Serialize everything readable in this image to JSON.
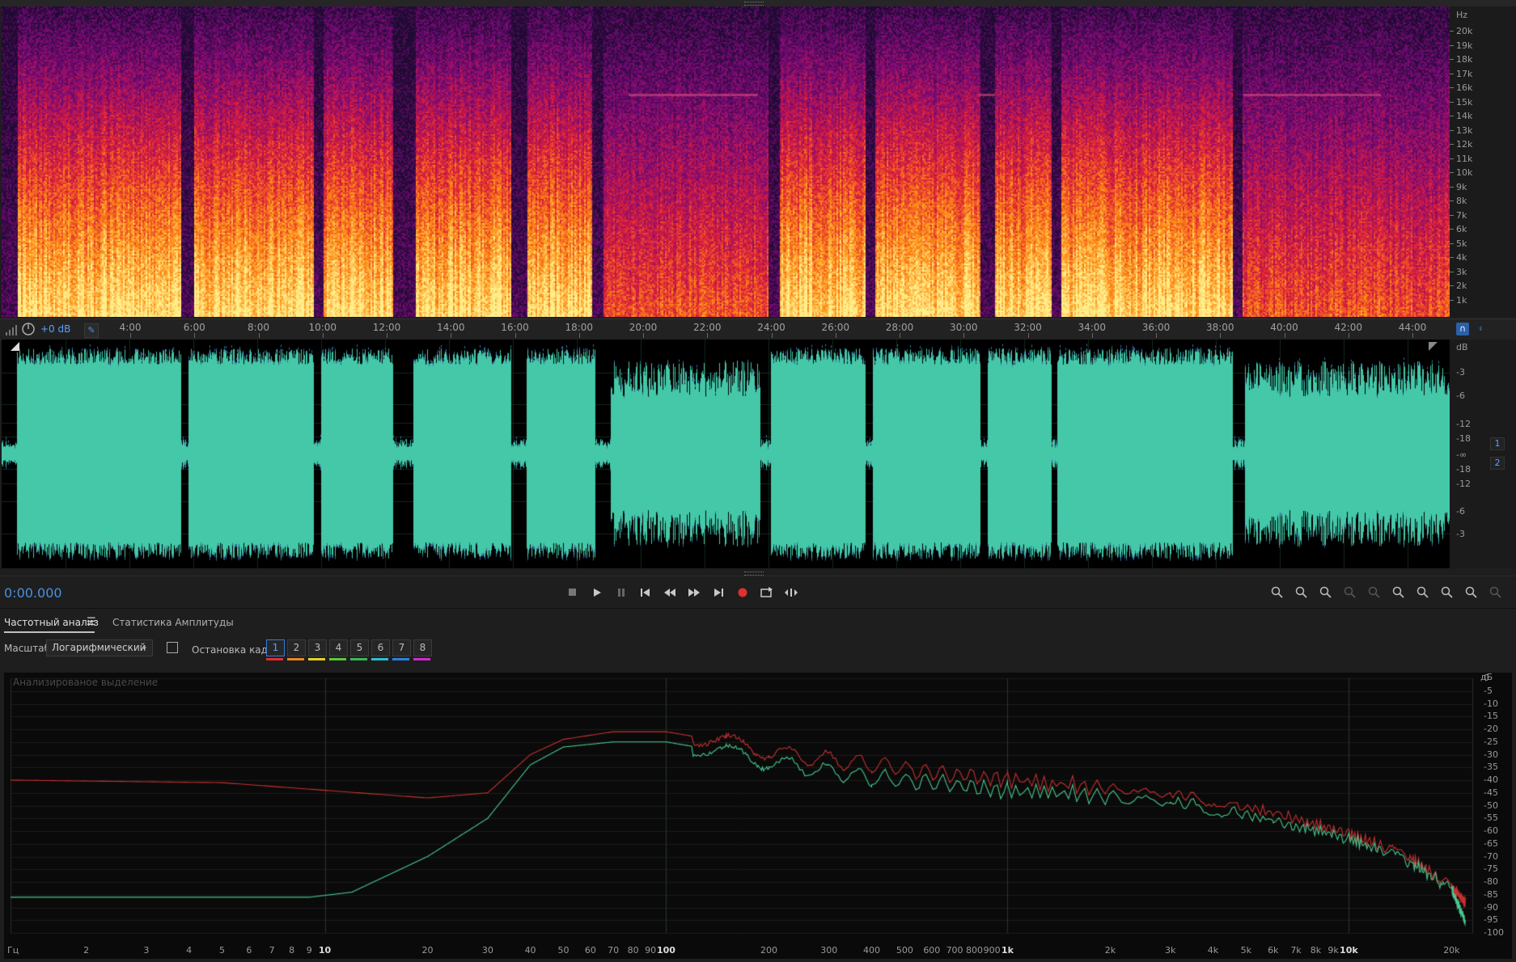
{
  "spectrogram": {
    "unit": "Hz",
    "freq_labels": [
      "20k",
      "19k",
      "18k",
      "17k",
      "16k",
      "15k",
      "14k",
      "13k",
      "12k",
      "11k",
      "10k",
      "9k",
      "8k",
      "7k",
      "6k",
      "5k",
      "4k",
      "3k",
      "2k",
      "1k"
    ]
  },
  "timeline": {
    "gain_label": "+0 dB",
    "labels": [
      "4:00",
      "6:00",
      "8:00",
      "10:00",
      "12:00",
      "14:00",
      "16:00",
      "18:00",
      "20:00",
      "22:00",
      "24:00",
      "26:00",
      "28:00",
      "30:00",
      "32:00",
      "34:00",
      "36:00",
      "38:00",
      "40:00",
      "42:00",
      "44:00"
    ]
  },
  "waveform": {
    "unit": "dB",
    "db_labels": [
      "-3",
      "-6",
      "-12",
      "-18",
      "-∞",
      "-18",
      "-12",
      "-6",
      "-3"
    ],
    "channels": [
      "1",
      "2"
    ],
    "color": "#44c8a8"
  },
  "transport": {
    "time": "0:00.000",
    "icons": [
      "stop-icon",
      "play-icon",
      "pause-icon",
      "skip-start-icon",
      "rewind-icon",
      "fast-forward-icon",
      "skip-end-icon",
      "record-icon",
      "loop-icon",
      "skip-selection-icon"
    ]
  },
  "zoom": {
    "icons": [
      "zoom-in-amplitude-icon",
      "zoom-out-amplitude-icon",
      "zoom-in-time-icon",
      "zoom-out-time-icon",
      "zoom-full-icon",
      "zoom-in-left-icon",
      "zoom-in-right-icon",
      "zoom-to-selection-icon",
      "zoom-reset-icon",
      "zoom-toggle-icon"
    ]
  },
  "analysis": {
    "tabs": [
      "Частотный анализ",
      "Статистика Амплитуды"
    ],
    "scale_label": "Масштаб:",
    "scale_value": "Логарифмический",
    "freeze_label": "Остановка кадра:",
    "frames": [
      "1",
      "2",
      "3",
      "4",
      "5",
      "6",
      "7",
      "8"
    ],
    "frame_colors": [
      "#e0302a",
      "#e8862a",
      "#e0d02a",
      "#58c83a",
      "#38b858",
      "#2ac0d0",
      "#2a80e0",
      "#d02ad0"
    ],
    "overlay_text": "Анализированое выделение",
    "freq_unit": "Гц",
    "db_unit": "дБ",
    "freq_labels": [
      "2",
      "3",
      "4",
      "5",
      "6",
      "7",
      "8",
      "9",
      "10",
      "20",
      "30",
      "40",
      "50",
      "60",
      "70",
      "80",
      "90",
      "100",
      "200",
      "300",
      "400",
      "500",
      "600",
      "700",
      "800",
      "900",
      "1k",
      "2k",
      "3k",
      "4k",
      "5k",
      "6k",
      "7k",
      "8k",
      "9k",
      "10k",
      "20k"
    ],
    "db_labels": [
      "0",
      "-5",
      "-10",
      "-15",
      "-20",
      "-25",
      "-30",
      "-35",
      "-40",
      "-45",
      "-50",
      "-55",
      "-60",
      "-65",
      "-70",
      "-75",
      "-80",
      "-85",
      "-90",
      "-95",
      "-100"
    ],
    "series_colors": {
      "left": "#c83030",
      "right": "#48c890"
    }
  }
}
